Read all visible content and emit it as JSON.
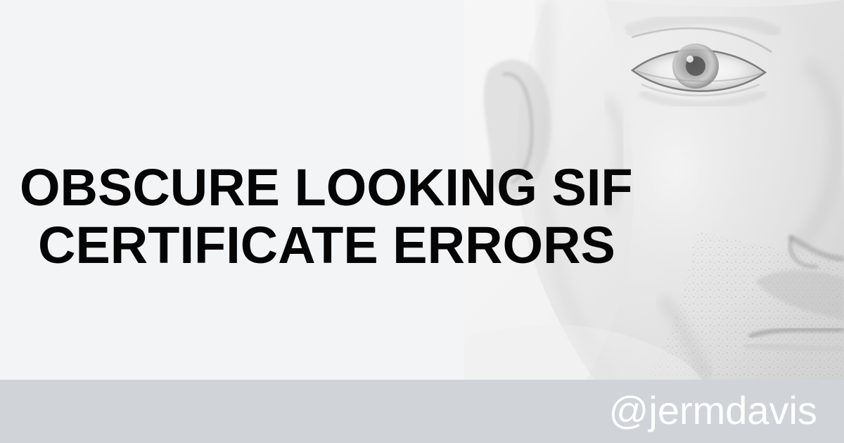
{
  "headline": {
    "line_1": "OBSCURE LOOKING SIF",
    "line_2": "CERTIFICATE ERRORS"
  },
  "footer": {
    "handle": "@jermdavis"
  },
  "image": {
    "subject": "man's face"
  },
  "colors": {
    "background": "#f3f4f6",
    "headline": "#050505",
    "footer": "#d0d3d8",
    "handle": "#ffffff"
  }
}
